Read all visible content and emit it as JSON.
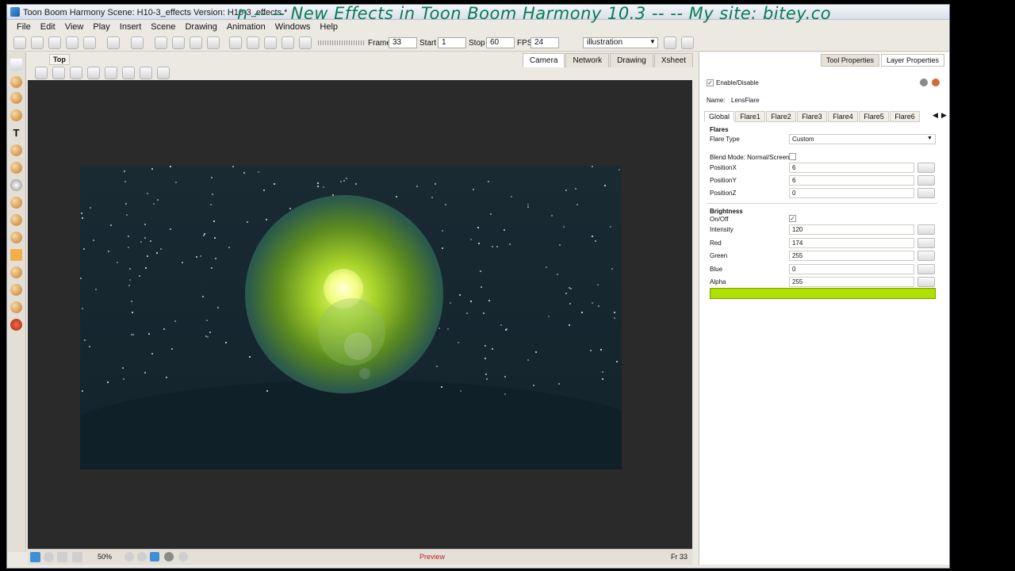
{
  "app": {
    "title": "Toon Boom Harmony Scene: H10-3_effects Version: H10-3_effects *",
    "banner": "n -- --   New Effects in Toon Boom Harmony 10.3 -- -- My site: bitey.co"
  },
  "menu": [
    "File",
    "Edit",
    "View",
    "Play",
    "Insert",
    "Scene",
    "Drawing",
    "Animation",
    "Windows",
    "Help"
  ],
  "toolbar": {
    "frame_label": "Frame",
    "frame_value": "33",
    "start_label": "Start",
    "start_value": "1",
    "stop_label": "Stop",
    "stop_value": "60",
    "fps_label": "FPS",
    "fps_value": "24",
    "mode_select": "illustration"
  },
  "view": {
    "top_tab": "Top",
    "tabs": [
      "Camera",
      "Network",
      "Drawing",
      "Xsheet"
    ],
    "active_tab": "Camera",
    "zoom": "50%",
    "status_preview": "Preview",
    "frame_readout": "Fr 33"
  },
  "panel": {
    "tabs": [
      "Tool Properties",
      "Layer Properties"
    ],
    "active_tab": "Layer Properties",
    "enable_label": "Enable/Disable",
    "name_label": "Name:",
    "name_value": "LensFlare",
    "fx_tabs": [
      "Global",
      "Flare1",
      "Flare2",
      "Flare3",
      "Flare4",
      "Flare5",
      "Flare6"
    ],
    "flares_header": "Flares",
    "flare_type_label": "Flare Type",
    "flare_type_value": "Custom",
    "blend_label": "Blend Mode: Normal/Screen",
    "position_x_label": "PositionX",
    "position_x": "6",
    "position_y_label": "PositionY",
    "position_y": "6",
    "position_z_label": "PositionZ",
    "position_z": "0",
    "brightness_header": "Brightness",
    "onoff_label": "On/Off",
    "intensity_label": "Intensity",
    "intensity": "120",
    "red_label": "Red",
    "red": "174",
    "green_label": "Green",
    "green": "255",
    "blue_label": "Blue",
    "blue": "0",
    "alpha_label": "Alpha",
    "alpha": "255",
    "swatch_color": "#aee000"
  },
  "colors": {
    "banner_green": "#0a7a52",
    "flare_core": "#e9ff7a",
    "sky": "#1a2a33"
  }
}
